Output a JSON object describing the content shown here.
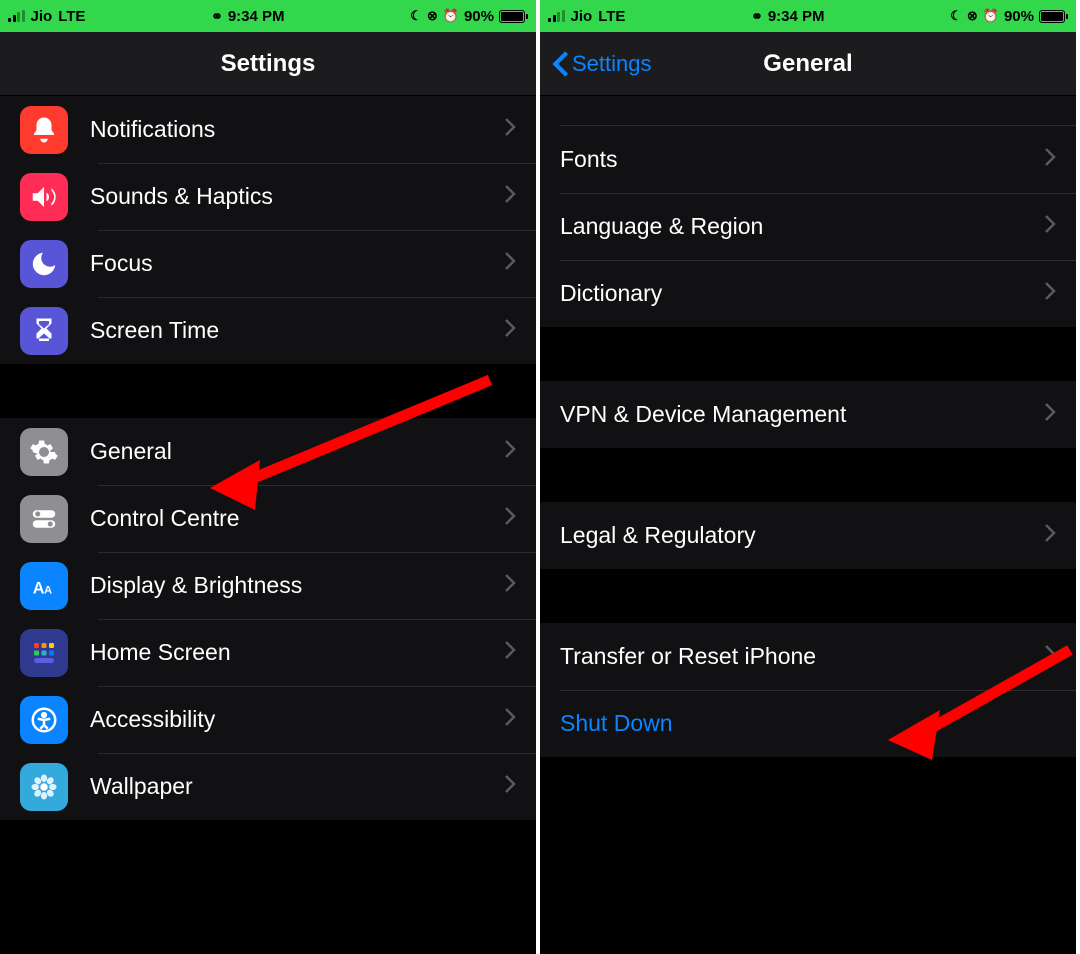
{
  "status": {
    "carrier": "Jio",
    "network": "LTE",
    "time": "9:34 PM",
    "battery_pct": "90%"
  },
  "left": {
    "title": "Settings",
    "items_group1": [
      {
        "label": "Notifications",
        "icon": "notifications"
      },
      {
        "label": "Sounds & Haptics",
        "icon": "sounds"
      },
      {
        "label": "Focus",
        "icon": "focus"
      },
      {
        "label": "Screen Time",
        "icon": "screentime"
      }
    ],
    "items_group2": [
      {
        "label": "General",
        "icon": "general"
      },
      {
        "label": "Control Centre",
        "icon": "control"
      },
      {
        "label": "Display & Brightness",
        "icon": "display"
      },
      {
        "label": "Home Screen",
        "icon": "home"
      },
      {
        "label": "Accessibility",
        "icon": "accessibility"
      },
      {
        "label": "Wallpaper",
        "icon": "wallpaper"
      }
    ]
  },
  "right": {
    "back": "Settings",
    "title": "General",
    "group1": [
      {
        "label": "Fonts"
      },
      {
        "label": "Language & Region"
      },
      {
        "label": "Dictionary"
      }
    ],
    "group2": [
      {
        "label": "VPN & Device Management"
      }
    ],
    "group3": [
      {
        "label": "Legal & Regulatory"
      }
    ],
    "group4": [
      {
        "label": "Transfer or Reset iPhone"
      },
      {
        "label": "Shut Down",
        "blue": true,
        "no_chevron": true
      }
    ]
  }
}
